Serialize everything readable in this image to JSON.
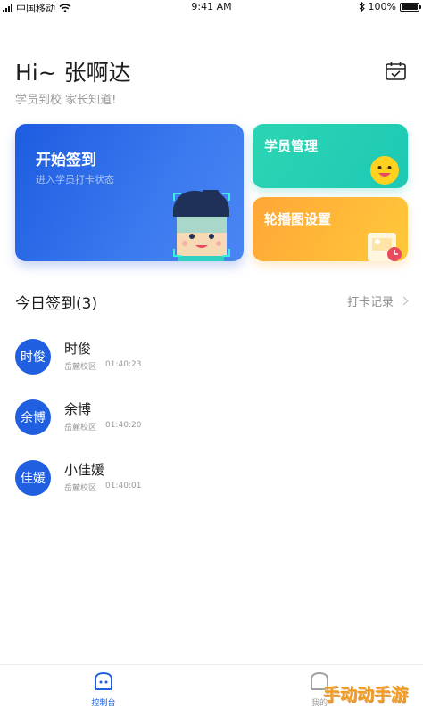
{
  "status_bar": {
    "carrier": "中国移动",
    "time": "9:41 AM",
    "battery": "100%",
    "battery_level": 1.0
  },
  "header": {
    "greeting": "Hi~ 张啊达",
    "subtitle": "学员到校 家长知道!",
    "calendar_icon": "calendar-check-icon"
  },
  "cards": {
    "checkin": {
      "title": "开始签到",
      "subtitle": "进入学员打卡状态"
    },
    "students": {
      "title": "学员管理"
    },
    "carousel": {
      "title": "轮播图设置"
    }
  },
  "section": {
    "title": "今日签到(3)",
    "link": "打卡记录"
  },
  "records": [
    {
      "avatar": "时俊",
      "name": "时俊",
      "campus": "岳麓校区",
      "time": "01:40:23"
    },
    {
      "avatar": "余博",
      "name": "余博",
      "campus": "岳麓校区",
      "time": "01:40:20"
    },
    {
      "avatar": "佳媛",
      "name": "小佳媛",
      "campus": "岳麓校区",
      "time": "01:40:01"
    }
  ],
  "tabbar": {
    "tabs": [
      {
        "label": "控制台"
      },
      {
        "label": "我的"
      }
    ]
  },
  "watermark": "手动动手游",
  "colors": {
    "primary": "#1f5fe0",
    "teal": "#22cdb3",
    "orange": "#ffb338"
  }
}
